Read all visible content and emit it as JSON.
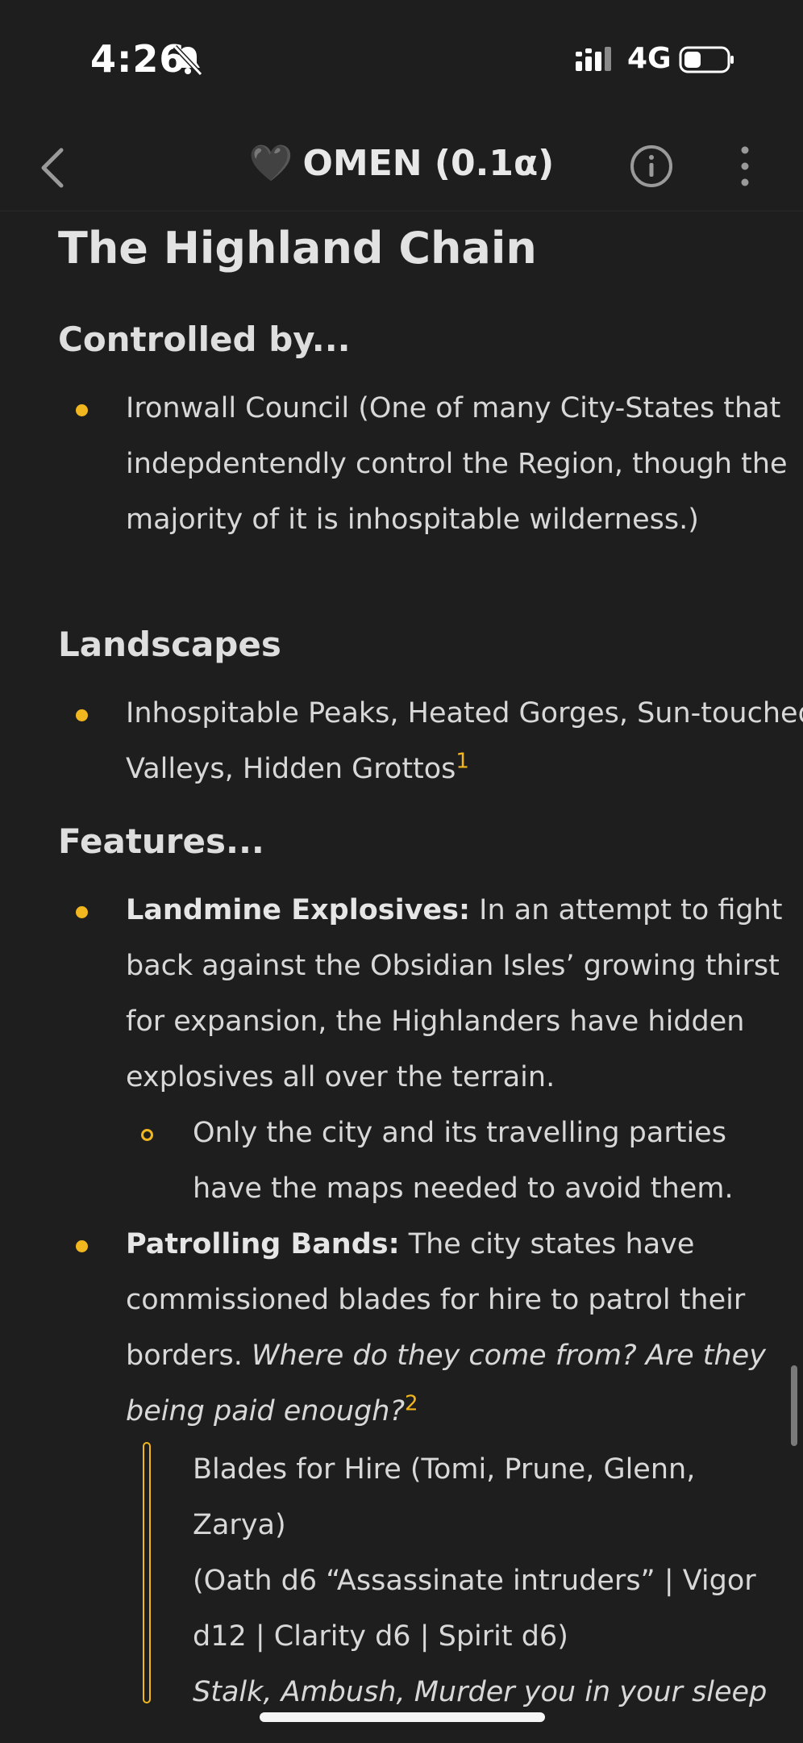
{
  "status_bar": {
    "time": "4:26",
    "network": "4G",
    "icons": [
      "bell-slash-icon",
      "signal-icon",
      "battery-icon"
    ]
  },
  "nav": {
    "heart_glyph": "🖤",
    "title": "OMEN (0.1α)",
    "icons": [
      "chevron-left-icon",
      "info-icon",
      "more-vertical-icon"
    ]
  },
  "page": {
    "title": "The Highland Chain",
    "controlled_heading": "Controlled by...",
    "controlled_item": "Ironwall Council (One of many City-States that indepdentendly control the Region, though the majority of it is inhospitable wilderness.)",
    "landscapes_heading": "Landscapes",
    "landscapes_item": "Inhospitable Peaks, Heated Gorges, Sun-touched Valleys, Hidden Grottos",
    "landscapes_footnote": "1",
    "features_heading": "Features...",
    "feature1_label": "Landmine Explosives:",
    "feature1_text": " In an attempt to fight back against the Obsidian Isles’ growing thirst for expansion, the Highlanders have hidden explosives all over the terrain.",
    "feature1_sub": "Only the city and its travelling parties have the maps needed to avoid them.",
    "feature2_label": "Patrolling Bands:",
    "feature2_text": " The city states have commissioned blades for hire to patrol their borders. ",
    "feature2_italic": "Where do they come from? Are they being paid enough?",
    "feature2_footnote": "2",
    "quote_line1": "Blades for Hire (Tomi, Prune, Glenn,",
    "quote_line2": "Zarya)",
    "quote_line3": "(Oath d6 “Assassinate intruders” | Vigor",
    "quote_line4": "d12 | Clarity d6 | Spirit d6)",
    "quote_line5": "Stalk, Ambush, Murder you in your sleep"
  },
  "colors": {
    "background": "#1e1e1e",
    "accent": "#f2b71f",
    "text": "#d8d8d8"
  }
}
